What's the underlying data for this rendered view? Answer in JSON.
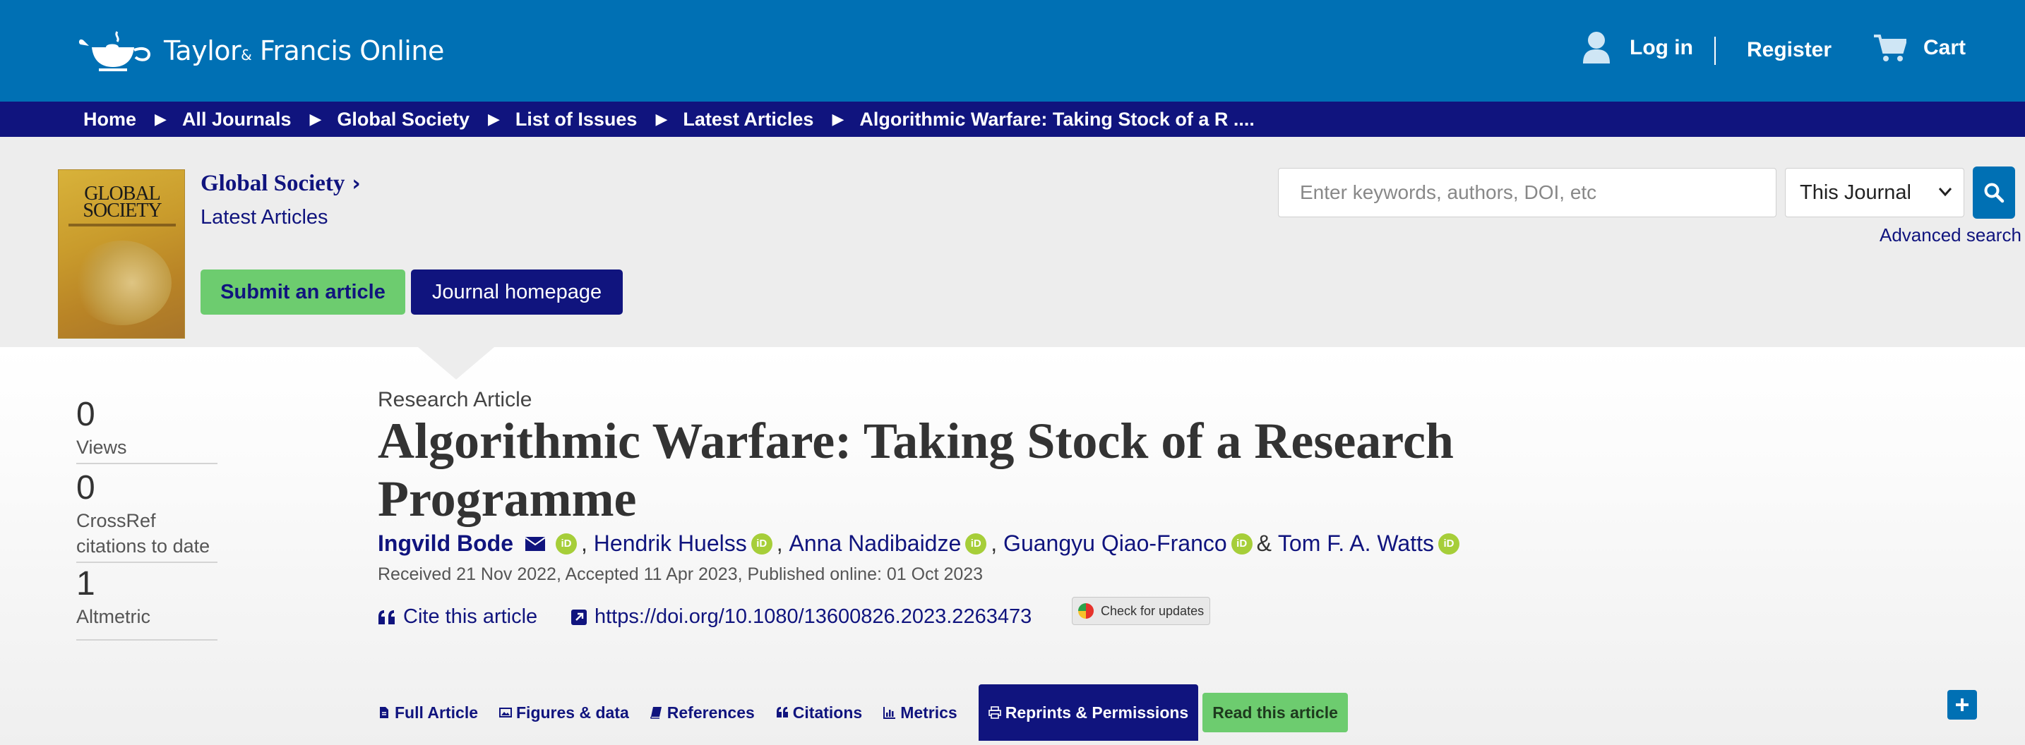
{
  "header": {
    "logo_text_a": "Taylor",
    "logo_text_amp": "&",
    "logo_text_b": "Francis Online",
    "login_label": "Log in",
    "register_label": "Register",
    "cart_label": "Cart"
  },
  "breadcrumb": [
    "Home",
    "All Journals",
    "Global Society",
    "List of Issues",
    "Latest Articles",
    "Algorithmic Warfare: Taking Stock of a R ...."
  ],
  "journal": {
    "cover_title": "GLOBAL SOCIETY",
    "title": "Global Society",
    "subtitle": "Latest Articles",
    "submit_label": "Submit an article",
    "homepage_label": "Journal homepage"
  },
  "search": {
    "placeholder": "Enter keywords, authors, DOI, etc",
    "scope": "This Journal",
    "advanced_label": "Advanced search"
  },
  "metrics": [
    {
      "value": "0",
      "label": "Views"
    },
    {
      "value": "0",
      "label": "CrossRef citations to date"
    },
    {
      "value": "1",
      "label": "Altmetric"
    }
  ],
  "article": {
    "type": "Research Article",
    "title": "Algorithmic Warfare: Taking Stock of a Research Programme",
    "authors": [
      "Ingvild Bode",
      "Hendrik Huelss",
      "Anna Nadibaidze",
      "Guangyu Qiao-Franco",
      "Tom F. A. Watts"
    ],
    "author_sep_comma": ",",
    "author_sep_amp": "&",
    "orcid_label": "iD",
    "dates": "Received 21 Nov 2022, Accepted 11 Apr 2023, Published online: 01 Oct 2023",
    "cite_label": "Cite this article",
    "doi": "https://doi.org/10.1080/13600826.2023.2263473",
    "updates_label": "Check for updates"
  },
  "tabs": [
    {
      "label": "Full Article",
      "icon": "file-icon"
    },
    {
      "label": "Figures & data",
      "icon": "image-icon"
    },
    {
      "label": "References",
      "icon": "book-icon"
    },
    {
      "label": "Citations",
      "icon": "quote-icon"
    },
    {
      "label": "Metrics",
      "icon": "bar-chart-icon"
    },
    {
      "label": "Reprints & Permissions",
      "icon": "print-icon"
    },
    {
      "label": "Read this article",
      "icon": ""
    }
  ],
  "colors": {
    "header_blue": "#0070b4",
    "navy": "#10147e",
    "green": "#6dcc6f",
    "orcid_green": "#a6ce39"
  }
}
